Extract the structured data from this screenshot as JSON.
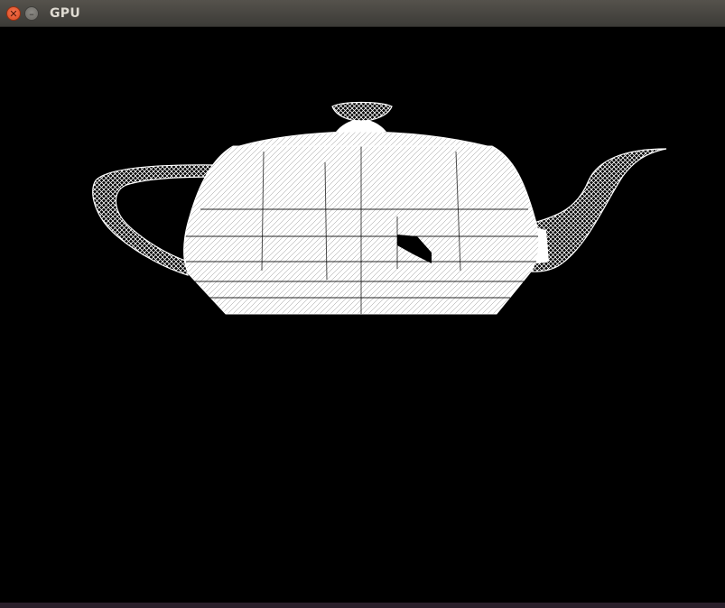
{
  "window": {
    "title": "GPU",
    "close_icon": "close-icon",
    "minimize_icon": "minimize-icon",
    "background": "#000000"
  },
  "scene": {
    "object": "teapot-wireframe",
    "fill_color": "#ffffff",
    "background_color": "#000000"
  }
}
